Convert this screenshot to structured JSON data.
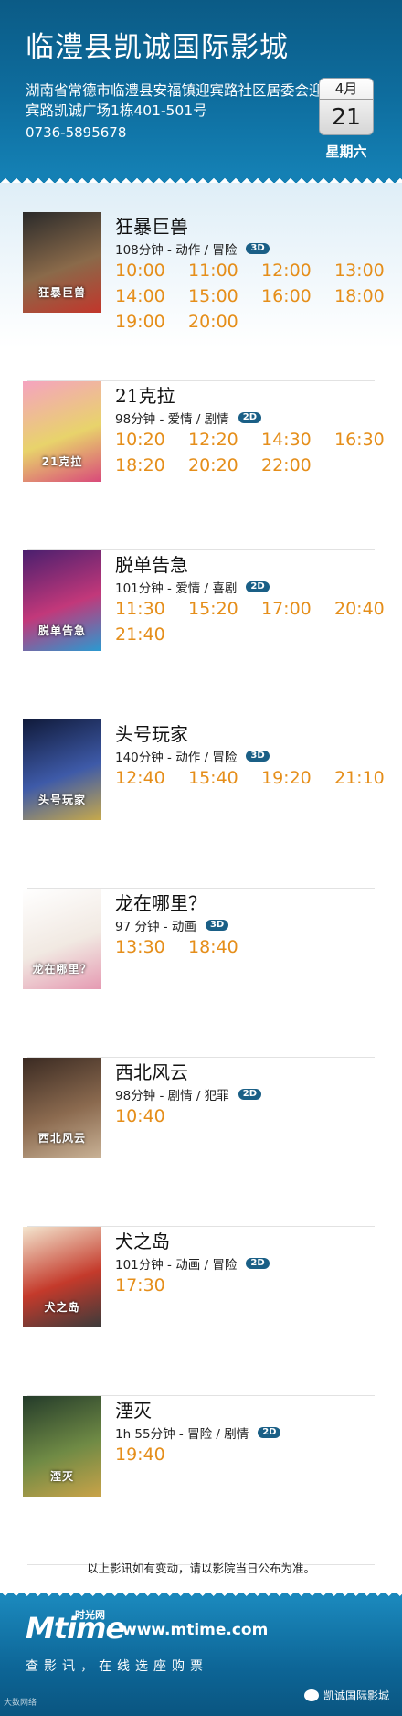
{
  "header": {
    "cinema_name": "临澧县凯诚国际影城",
    "address": "湖南省常德市临澧县安福镇迎宾路社区居委会迎宾路凯诚广场1栋401-501号",
    "phone": "0736-5895678",
    "month": "4月",
    "day": "21",
    "weekday": "星期六"
  },
  "movies": [
    {
      "title": "狂暴巨兽",
      "meta": "108分钟 - 动作 / 冒险",
      "format": "3D",
      "poster_text": "狂暴巨兽",
      "poster_colors": [
        "#2a2a2a",
        "#8a6a4a",
        "#c2362b"
      ],
      "times": [
        "10:00",
        "11:00",
        "12:00",
        "13:00",
        "14:00",
        "15:00",
        "16:00",
        "18:00",
        "19:00",
        "20:00"
      ]
    },
    {
      "title": "21克拉",
      "meta": "98分钟 - 爱情 / 剧情",
      "format": "2D",
      "poster_text": "21克拉",
      "poster_colors": [
        "#f5a3c0",
        "#e8d36b",
        "#d94a7a"
      ],
      "times": [
        "10:20",
        "12:20",
        "14:30",
        "16:30",
        "18:20",
        "20:20",
        "22:00"
      ]
    },
    {
      "title": "脱单告急",
      "meta": "101分钟 - 爱情 / 喜剧",
      "format": "2D",
      "poster_text": "脱单告急",
      "poster_colors": [
        "#4a1f6e",
        "#c2387a",
        "#2a9ad1"
      ],
      "times": [
        "11:30",
        "15:20",
        "17:00",
        "20:40",
        "21:40"
      ]
    },
    {
      "title": "头号玩家",
      "meta": "140分钟 - 动作 / 冒险",
      "format": "3D",
      "poster_text": "头号玩家",
      "poster_colors": [
        "#101a3a",
        "#3e5aa8",
        "#c7a94b"
      ],
      "times": [
        "12:40",
        "15:40",
        "19:20",
        "21:10"
      ]
    },
    {
      "title": "龙在哪里？",
      "meta": "97 分钟 - 动画",
      "format": "3D",
      "poster_text": "龙在哪里？",
      "poster_colors": [
        "#ffffff",
        "#f1e9e2",
        "#e59ab2"
      ],
      "times": [
        "13:30",
        "18:40"
      ]
    },
    {
      "title": "西北风云",
      "meta": "98分钟 - 剧情 / 犯罪",
      "format": "2D",
      "poster_text": "西北风云",
      "poster_colors": [
        "#3a2a22",
        "#8b6a4f",
        "#c9b296"
      ],
      "times": [
        "10:40"
      ]
    },
    {
      "title": "犬之岛",
      "meta": "101分钟 - 动画 / 冒险",
      "format": "2D",
      "poster_text": "犬之岛",
      "poster_colors": [
        "#f4e6cf",
        "#c43a2b",
        "#3b3b3b"
      ],
      "times": [
        "17:30"
      ]
    },
    {
      "title": "湮灭",
      "meta": "1h 55分钟 - 冒险 / 剧情",
      "format": "2D",
      "poster_text": "湮灭",
      "poster_colors": [
        "#243b2a",
        "#6f8a45",
        "#c9a349"
      ],
      "times": [
        "19:40"
      ]
    }
  ],
  "notice": "以上影讯如有变动，请以影院当日公布为准。",
  "footer": {
    "logo": "Mtime",
    "logo_cn": "时光网",
    "url": "www.mtime.com",
    "slogan": "查影讯，在线选座购票",
    "wechat_name": "凯诚国际影城",
    "watermark": "大数网络"
  }
}
